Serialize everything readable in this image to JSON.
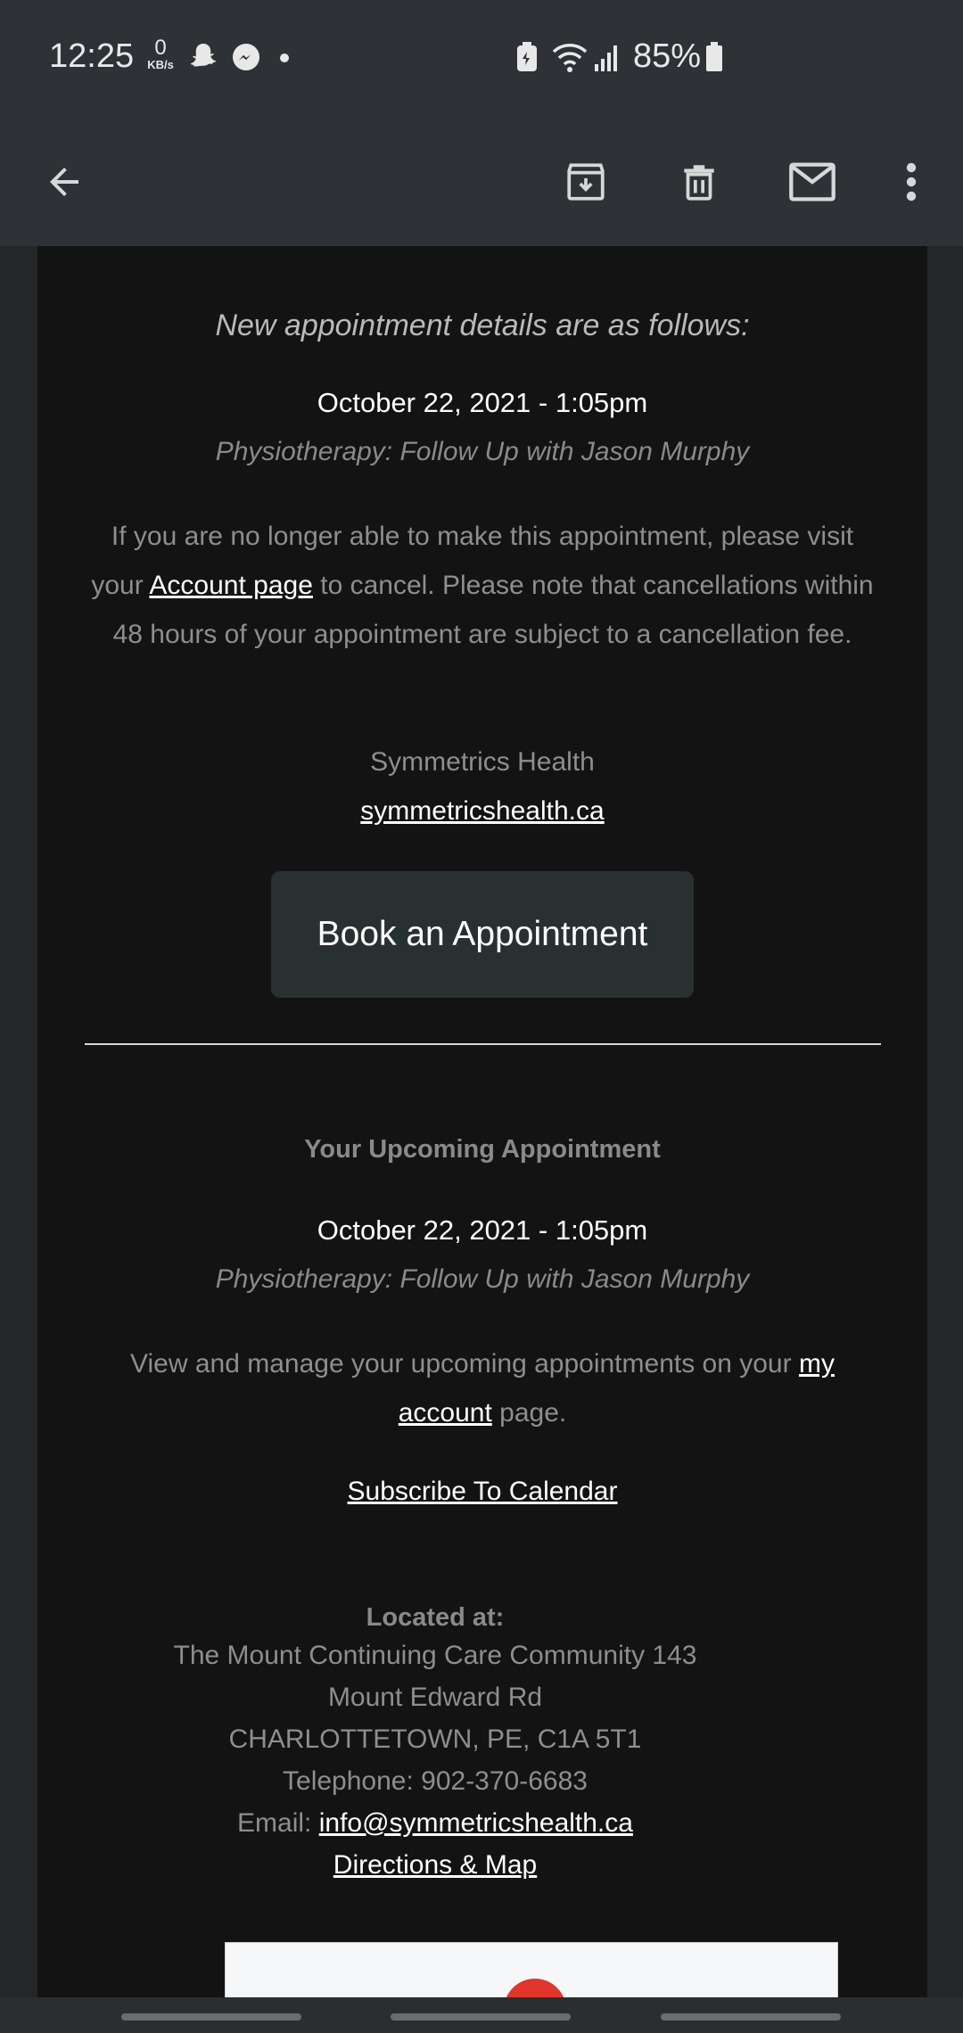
{
  "status_bar": {
    "time": "12:25",
    "net_speed_value": "0",
    "net_speed_unit": "KB/s",
    "notification_icons": [
      "snapchat-icon",
      "messenger-icon",
      "dot-icon"
    ],
    "system_icons": [
      "battery-saver-icon",
      "wifi-icon",
      "signal-icon",
      "battery-icon"
    ],
    "battery_percent": "85%"
  },
  "app_bar": {
    "actions": [
      "back-arrow-icon",
      "archive-icon",
      "delete-icon",
      "mark-unread-icon",
      "more-vert-icon"
    ]
  },
  "email": {
    "intro": "New appointment details are as follows:",
    "new_appointment": {
      "date": "October 22, 2021 - 1:05pm",
      "service": "Physiotherapy: Follow Up with Jason Murphy"
    },
    "cancel_notice": {
      "before": "If you are no longer able to make this appointment, please visit your",
      "link": "Account page",
      "after": "to cancel. Please note that cancellations within 48 hours of your appointment are subject to a cancellation fee."
    },
    "org_name": "Symmetrics Health",
    "org_url": "symmetricshealth.ca",
    "book_button": "Book an Appointment",
    "upcoming": {
      "title": "Your Upcoming Appointment",
      "date": "October 22, 2021 - 1:05pm",
      "service": "Physiotherapy: Follow Up with Jason Murphy",
      "manage_before": "View and manage your upcoming appointments on your",
      "manage_link": "my account",
      "manage_after": "page.",
      "subscribe": "Subscribe To Calendar"
    },
    "location": {
      "heading": "Located at:",
      "line1": "The Mount Continuing Care Community 143",
      "line2": "Mount Edward Rd",
      "line3": "CHARLOTTETOWN, PE, C1A 5T1",
      "telephone": "Telephone: 902-370-6683",
      "email_label": "Email:",
      "email": "info@symmetricshealth.ca",
      "directions": "Directions & Map"
    }
  },
  "colors": {
    "status_bar_bg": "#2e3136",
    "content_bg": "#131313",
    "button_bg": "#293032",
    "link": "#ffffff",
    "muted_text": "#8e8e8e"
  }
}
